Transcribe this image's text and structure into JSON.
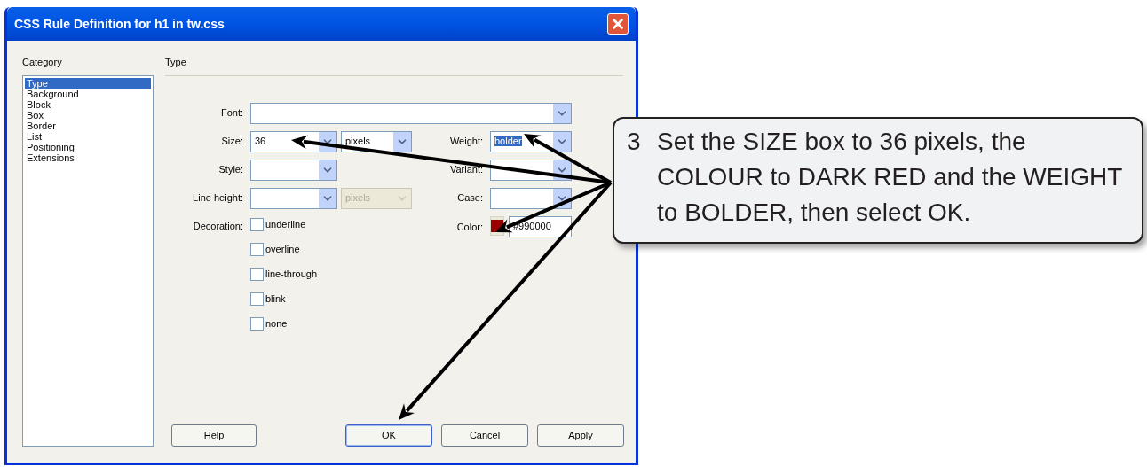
{
  "window": {
    "title": "CSS Rule Definition for h1 in tw.css"
  },
  "category": {
    "label": "Category",
    "items": [
      {
        "label": "Type",
        "selected": true
      },
      {
        "label": "Background",
        "selected": false
      },
      {
        "label": "Block",
        "selected": false
      },
      {
        "label": "Box",
        "selected": false
      },
      {
        "label": "Border",
        "selected": false
      },
      {
        "label": "List",
        "selected": false
      },
      {
        "label": "Positioning",
        "selected": false
      },
      {
        "label": "Extensions",
        "selected": false
      }
    ]
  },
  "panel": {
    "title": "Type"
  },
  "font": {
    "label": "Font:"
  },
  "size": {
    "label": "Size:",
    "value": "36",
    "unit": "pixels"
  },
  "weight": {
    "label": "Weight:",
    "value": "bolder",
    "highlighted": true
  },
  "style": {
    "label": "Style:"
  },
  "variant": {
    "label": "Variant:"
  },
  "line_height": {
    "label": "Line height:",
    "unit": "pixels",
    "unit_disabled": true
  },
  "case": {
    "label": "Case:"
  },
  "decoration": {
    "label": "Decoration:",
    "options": [
      {
        "label": "underline",
        "checked": false
      },
      {
        "label": "overline",
        "checked": false
      },
      {
        "label": "line-through",
        "checked": false
      },
      {
        "label": "blink",
        "checked": false
      },
      {
        "label": "none",
        "checked": false
      }
    ]
  },
  "color": {
    "label": "Color:",
    "value": "#990000"
  },
  "buttons": [
    {
      "label": "Help",
      "default": false
    },
    {
      "label": "OK",
      "default": true
    },
    {
      "label": "Cancel",
      "default": false
    },
    {
      "label": "Apply",
      "default": false
    }
  ],
  "callout": {
    "number": "3",
    "text": "Set the SIZE box to 36 pixels, the COLOUR to DARK RED and the WEIGHT to BOLDER, then select OK."
  }
}
